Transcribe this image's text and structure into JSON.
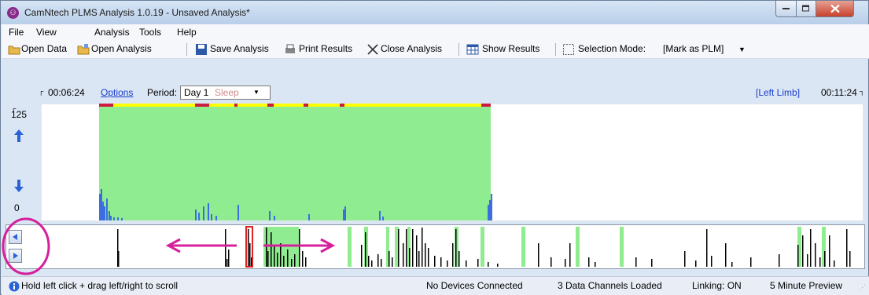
{
  "window": {
    "title": "CamNtech PLMS Analysis 1.0.19 - Unsaved Analysis*"
  },
  "menu": [
    "File",
    "View",
    "Analysis",
    "Tools",
    "Help"
  ],
  "toolbar": {
    "open_data": "Open Data",
    "open_analysis": "Open Analysis",
    "save_analysis": "Save Analysis",
    "print_results": "Print Results",
    "close_analysis": "Close Analysis",
    "show_results": "Show Results",
    "selection_mode_label": "Selection Mode:",
    "selection_mode_value": "[Mark as PLM]"
  },
  "controls": {
    "start_time": "00:06:24",
    "options": "Options",
    "period_label": "Period:",
    "period_day": "Day 1",
    "period_state": "Sleep",
    "limb": "[Left Limb]",
    "end_time": "00:11:24"
  },
  "graph": {
    "y_max": "125",
    "y_min": "0",
    "colors": {
      "sleep": "#90ec90",
      "marker": "#ffff00",
      "plm": "#cc1a40",
      "activity": "#3c6ee0"
    }
  },
  "status": {
    "hint": "Hold left click + drag left/right to scroll",
    "devices": "No Devices Connected",
    "channels": "3 Data Channels Loaded",
    "linking": "Linking: ON",
    "preview": "5 Minute Preview"
  }
}
